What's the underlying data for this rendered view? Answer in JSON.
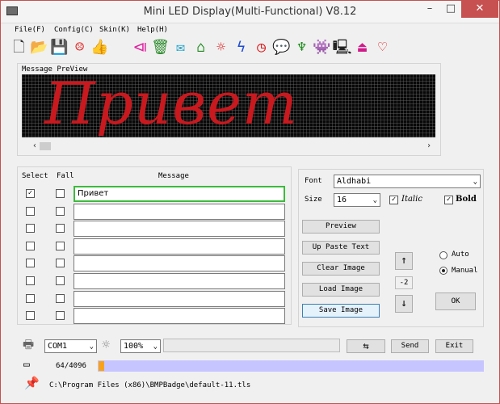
{
  "window": {
    "title": "Mini LED Display(Multi-Functional) V8.12",
    "minimize": "–",
    "maximize": "□",
    "close": "✕"
  },
  "menu": [
    {
      "label": "File(F)"
    },
    {
      "label": "Config(C)"
    },
    {
      "label": "Skin(K)"
    },
    {
      "label": "Help(H)"
    }
  ],
  "toolbar": [
    {
      "icon": "new-file-icon",
      "glyph": "🗋",
      "color": "#333"
    },
    {
      "icon": "open-folder-icon",
      "glyph": "📂",
      "color": "#d8a21a"
    },
    {
      "icon": "save-icon",
      "glyph": "💾",
      "color": "#333"
    },
    {
      "icon": "smiley-icon",
      "glyph": "☹",
      "color": "#d11"
    },
    {
      "icon": "thumbs-up-icon",
      "glyph": "👍",
      "color": "#b88a2a"
    },
    {
      "icon": "apple-icon",
      "glyph": "",
      "color": "#2a9a2a"
    },
    {
      "icon": "skip-icon",
      "glyph": "⧏",
      "color": "#e020a0"
    },
    {
      "icon": "trash-icon",
      "glyph": "🗑",
      "color": "#2a8a2a"
    },
    {
      "icon": "mail-icon",
      "glyph": "✉",
      "color": "#1aa0c8"
    },
    {
      "icon": "home-icon",
      "glyph": "⌂",
      "color": "#1a8a1a"
    },
    {
      "icon": "sun-icon",
      "glyph": "☼",
      "color": "#d11"
    },
    {
      "icon": "lightning-icon",
      "glyph": "ϟ",
      "color": "#1a4ad8"
    },
    {
      "icon": "clock-icon",
      "glyph": "◷",
      "color": "#d11"
    },
    {
      "icon": "chat-icon",
      "glyph": "💬",
      "color": "#d11"
    },
    {
      "icon": "plant-icon",
      "glyph": "♆",
      "color": "#1a8a1a"
    },
    {
      "icon": "space-invader-icon",
      "glyph": "👾",
      "color": "#1a2ad8"
    },
    {
      "icon": "computer-icon",
      "glyph": "🖳",
      "color": "#222"
    },
    {
      "icon": "badge-icon",
      "glyph": "⏏",
      "color": "#d11a8a"
    },
    {
      "icon": "heart-icon",
      "glyph": "♡",
      "color": "#d11"
    }
  ],
  "preview": {
    "label": "Message PreView",
    "text": "Привет",
    "color": "#c8191f"
  },
  "table": {
    "col_select": "Select",
    "col_fall": "Fall",
    "col_message": "Message"
  },
  "rows": [
    {
      "select": true,
      "fall": false,
      "message": "Привет",
      "active": true
    },
    {
      "select": false,
      "fall": false,
      "message": ""
    },
    {
      "select": false,
      "fall": false,
      "message": ""
    },
    {
      "select": false,
      "fall": false,
      "message": ""
    },
    {
      "select": false,
      "fall": false,
      "message": ""
    },
    {
      "select": false,
      "fall": false,
      "message": ""
    },
    {
      "select": false,
      "fall": false,
      "message": ""
    },
    {
      "select": false,
      "fall": false,
      "message": ""
    }
  ],
  "settings": {
    "font_label": "Font",
    "font_value": "Aldhabi",
    "size_label": "Size",
    "size_value": "16",
    "italic_label": "Italic",
    "italic_checked": true,
    "bold_label": "Bold",
    "bold_checked": true,
    "preview_btn": "Preview",
    "up_paste_btn": "Up Paste Text",
    "clear_btn": "Clear Image",
    "load_btn": "Load Image",
    "save_btn": "Save Image",
    "up_arrow": "↑",
    "step_value": "-2",
    "down_arrow": "↓",
    "auto_label": "Auto",
    "manual_label": "Manual",
    "mode": "Manual",
    "ok_btn": "OK"
  },
  "bottom": {
    "port_value": "COM1",
    "brightness_value": "100%",
    "status_text": "",
    "usb_icon": "⇆",
    "send_btn": "Send",
    "exit_btn": "Exit",
    "capacity_text": "64/4096",
    "capacity_fraction": 0.0156,
    "path": "C:\\Program Files (x86)\\BMPBadge\\default-11.tls"
  },
  "colors": {
    "progress_track": "#c7c5ff",
    "progress_fill": "#f7a21b",
    "active_border": "#3cba3c",
    "close": "#c75050"
  }
}
